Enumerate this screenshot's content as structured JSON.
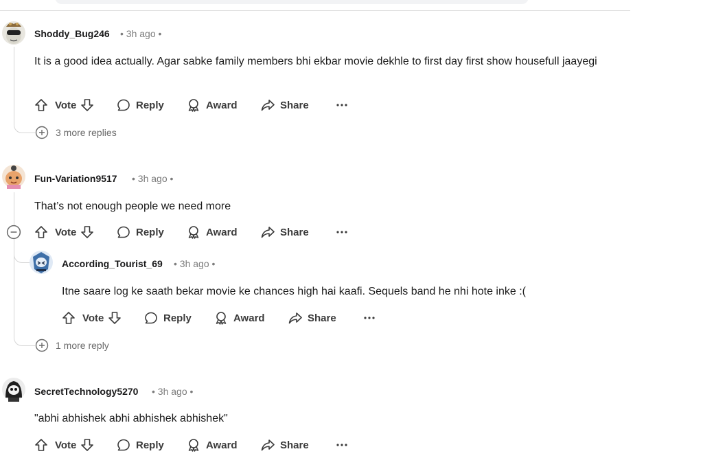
{
  "comments": [
    {
      "username": "Shoddy_Bug246",
      "time": "3h ago",
      "text": "It is a good idea actually. Agar sabke family members bhi ekbar movie dekhle to first day first show housefull jaayegi",
      "more_replies": "3 more replies"
    },
    {
      "username": "Fun-Variation9517",
      "time": "3h ago",
      "text": "That’s not enough people we need more",
      "reply": {
        "username": "According_Tourist_69",
        "time": "3h ago",
        "text": "Itne saare log ke saath bekar movie ke chances high hai kaafi. Sequels band he nhi hote inke :("
      },
      "more_replies": "1 more reply"
    },
    {
      "username": "SecretTechnology5270",
      "time": "3h ago",
      "text": "\"abhi abhishek abhi abhishek abhishek\""
    }
  ],
  "actions": {
    "vote": "Vote",
    "reply": "Reply",
    "award": "Award",
    "share": "Share",
    "more": "···"
  },
  "meta_separator": "•",
  "icons": [
    "upvote-icon",
    "downvote-icon",
    "reply-bubble-icon",
    "award-icon",
    "share-arrow-icon",
    "more-dots-icon",
    "plus-circle-icon",
    "minus-circle-icon"
  ],
  "colors": {
    "text": "#1c1c1c",
    "meta": "#7c7c7c",
    "line": "#d6d6d6"
  }
}
